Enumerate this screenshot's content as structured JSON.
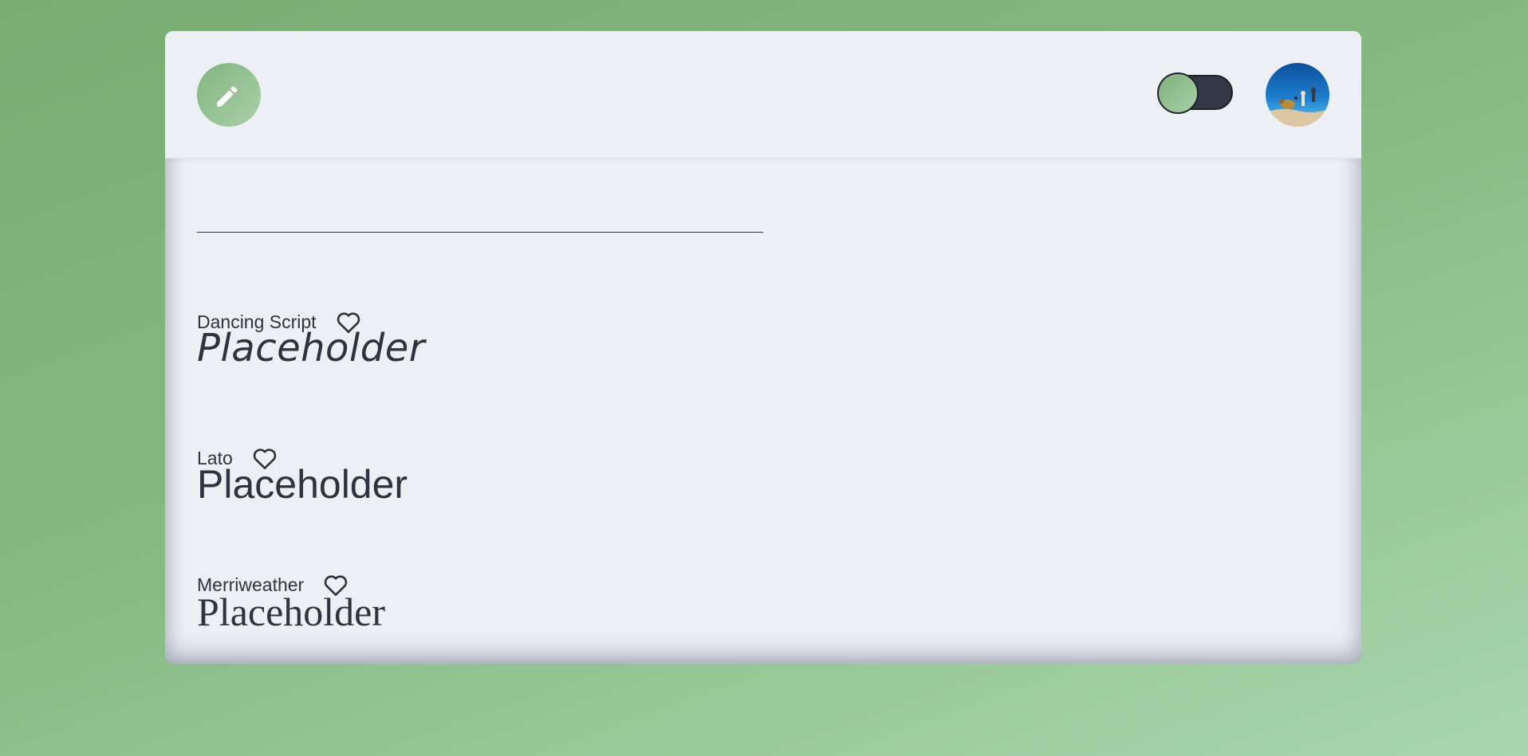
{
  "header": {
    "logo_icon": "pencil-icon",
    "theme_toggle": {
      "state": "off",
      "icon": "toggle-switch"
    },
    "avatar_icon": "profile-avatar-underwater"
  },
  "search": {
    "value": "",
    "placeholder": ""
  },
  "fonts": [
    {
      "name": "Dancing Script",
      "favorite_icon": "heart-outline-icon",
      "sample": "Placeholder"
    },
    {
      "name": "Lato",
      "favorite_icon": "heart-outline-icon",
      "sample": "Placeholder"
    },
    {
      "name": "Merriweather",
      "favorite_icon": "heart-outline-icon",
      "sample": "Placeholder"
    }
  ],
  "colors": {
    "background_start": "#79ad74",
    "background_end": "#a9d6ad",
    "card": "#eceff4",
    "text": "#2e3340",
    "accent": "#83b47f",
    "toggle_track": "#333746"
  }
}
